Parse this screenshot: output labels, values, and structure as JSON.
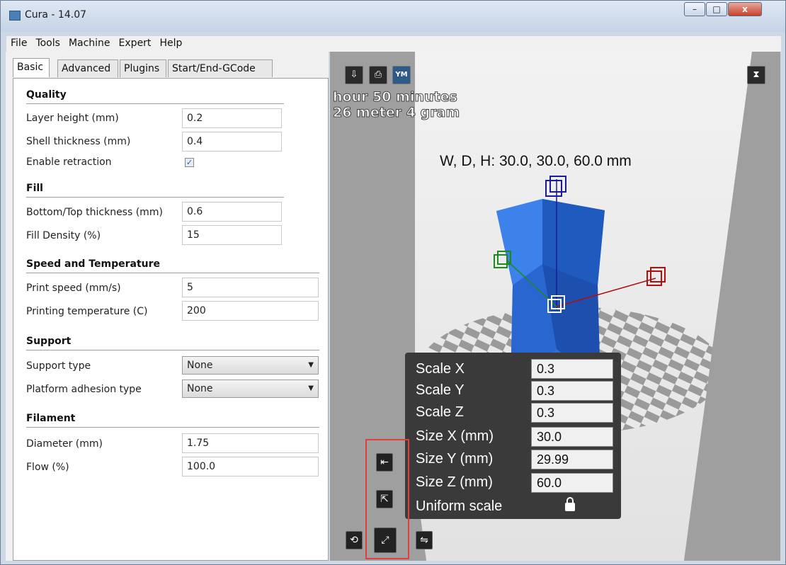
{
  "window": {
    "title": "Cura - 14.07",
    "controls": {
      "minimize": "–",
      "maximize": "□",
      "close": "x"
    }
  },
  "menu": [
    "File",
    "Tools",
    "Machine",
    "Expert",
    "Help"
  ],
  "tabs": [
    "Basic",
    "Advanced",
    "Plugins",
    "Start/End-GCode"
  ],
  "quality": {
    "heading": "Quality",
    "layer_height": {
      "label": "Layer height (mm)",
      "value": "0.2"
    },
    "shell_thickness": {
      "label": "Shell thickness (mm)",
      "value": "0.4"
    },
    "retraction": {
      "label": "Enable retraction",
      "checked": true
    }
  },
  "fill": {
    "heading": "Fill",
    "bottom_top": {
      "label": "Bottom/Top thickness (mm)",
      "value": "0.6"
    },
    "density": {
      "label": "Fill Density (%)",
      "value": "15"
    }
  },
  "speed": {
    "heading": "Speed and Temperature",
    "print_speed": {
      "label": "Print speed (mm/s)",
      "value": "5"
    },
    "temperature": {
      "label": "Printing temperature (C)",
      "value": "200"
    }
  },
  "support": {
    "heading": "Support",
    "support_type": {
      "label": "Support type",
      "value": "None"
    },
    "adhesion": {
      "label": "Platform adhesion type",
      "value": "None"
    }
  },
  "filament": {
    "heading": "Filament",
    "diameter": {
      "label": "Diameter (mm)",
      "value": "1.75"
    },
    "flow": {
      "label": "Flow (%)",
      "value": "100.0"
    }
  },
  "viewport": {
    "print_time": "hour 50 minutes",
    "filament_usage": "26 meter 4 gram",
    "dimensions": "W, D, H: 30.0, 30.0, 60.0 mm",
    "ym_label": "YM",
    "colors": {
      "model": "#2f6fd8",
      "background": "#9f9f9f",
      "x_axis": "#b01010",
      "y_axis": "#1d8a1d",
      "z_axis": "#1a1a9a"
    }
  },
  "scale_panel": {
    "scale_x": {
      "label": "Scale X",
      "value": "0.3"
    },
    "scale_y": {
      "label": "Scale Y",
      "value": "0.3"
    },
    "scale_z": {
      "label": "Scale Z",
      "value": "0.3"
    },
    "size_x": {
      "label": "Size X (mm)",
      "value": "30.0"
    },
    "size_y": {
      "label": "Size Y (mm)",
      "value": "29.99"
    },
    "size_z": {
      "label": "Size Z (mm)",
      "value": "60.0"
    },
    "uniform": {
      "label": "Uniform scale",
      "locked": true
    }
  }
}
